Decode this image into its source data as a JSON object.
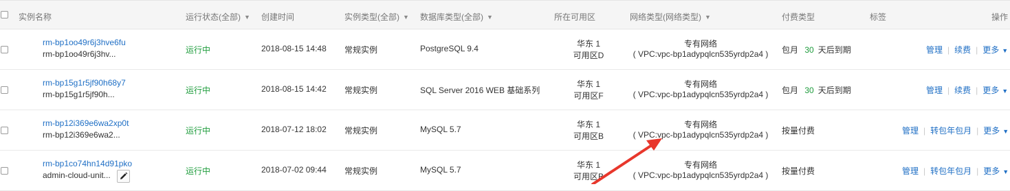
{
  "header": {
    "instance_name": "实例名称",
    "status": "运行状态(全部)",
    "created": "创建时间",
    "instance_type": "实例类型(全部)",
    "db_type": "数据库类型(全部)",
    "zone": "所在可用区",
    "network": "网络类型(网络类型)",
    "billing": "付费类型",
    "tags": "标签",
    "ops": "操作"
  },
  "rows": [
    {
      "id": "rm-bp1oo49r6j3hve6fu",
      "name": "rm-bp1oo49r6j3hv...",
      "status": "运行中",
      "created": "2018-08-15 14:48",
      "type": "常规实例",
      "db": "PostgreSQL 9.4",
      "zone_line1": "华东 1",
      "zone_line2": "可用区D",
      "net_line1": "专有网络",
      "net_line2": "( VPC:vpc-bp1adypqlcn535yrdp2a4 )",
      "billing_prefix": "包月",
      "billing_days": "30",
      "billing_suffix": "天后到期",
      "ops": [
        "管理",
        "续费",
        "更多"
      ]
    },
    {
      "id": "rm-bp15g1r5jf90h68y7",
      "name": "rm-bp15g1r5jf90h...",
      "status": "运行中",
      "created": "2018-08-15 14:42",
      "type": "常规实例",
      "db": "SQL Server 2016 WEB 基础系列",
      "zone_line1": "华东 1",
      "zone_line2": "可用区F",
      "net_line1": "专有网络",
      "net_line2": "( VPC:vpc-bp1adypqlcn535yrdp2a4 )",
      "billing_prefix": "包月",
      "billing_days": "30",
      "billing_suffix": "天后到期",
      "ops": [
        "管理",
        "续费",
        "更多"
      ]
    },
    {
      "id": "rm-bp12i369e6wa2xp0t",
      "name": "rm-bp12i369e6wa2...",
      "status": "运行中",
      "created": "2018-07-12 18:02",
      "type": "常规实例",
      "db": "MySQL 5.7",
      "zone_line1": "华东 1",
      "zone_line2": "可用区B",
      "net_line1": "专有网络",
      "net_line2": "( VPC:vpc-bp1adypqlcn535yrdp2a4 )",
      "billing_text": "按量付费",
      "ops": [
        "管理",
        "转包年包月",
        "更多"
      ]
    },
    {
      "id": "rm-bp1co74hn14d91pko",
      "name": "admin-cloud-unit...",
      "status": "运行中",
      "created": "2018-07-02 09:44",
      "type": "常规实例",
      "db": "MySQL 5.7",
      "zone_line1": "华东 1",
      "zone_line2": "可用区B",
      "net_line1": "专有网络",
      "net_line2": "( VPC:vpc-bp1adypqlcn535yrdp2a4 )",
      "billing_text": "按量付费",
      "ops": [
        "管理",
        "转包年包月",
        "更多"
      ]
    }
  ],
  "colors": {
    "link": "#1f6fc5",
    "running": "#1e9c3c",
    "arrow": "#e8372c"
  }
}
